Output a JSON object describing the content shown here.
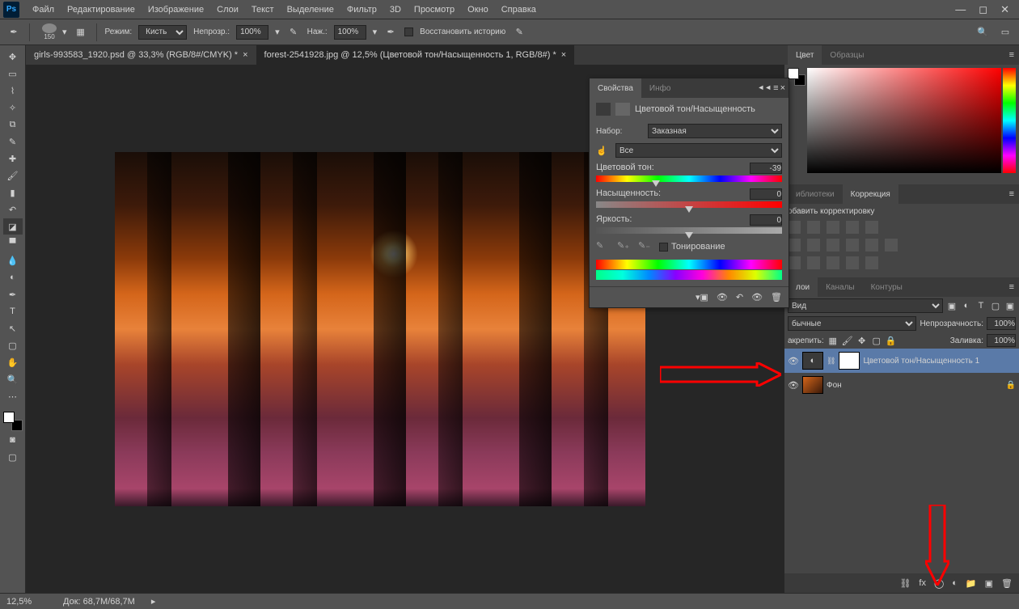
{
  "menu": {
    "items": [
      "Файл",
      "Редактирование",
      "Изображение",
      "Слои",
      "Текст",
      "Выделение",
      "Фильтр",
      "3D",
      "Просмотр",
      "Окно",
      "Справка"
    ]
  },
  "options": {
    "brush_size": "150",
    "mode_label": "Режим:",
    "mode_value": "Кисть",
    "opacity_label": "Непрозр.:",
    "opacity_value": "100%",
    "flow_label": "Наж.:",
    "flow_value": "100%",
    "restore_label": "Восстановить историю"
  },
  "tabs": [
    {
      "title": "girls-993583_1920.psd @ 33,3% (RGB/8#/CMYK) *",
      "active": false
    },
    {
      "title": "forest-2541928.jpg @ 12,5% (Цветовой тон/Насыщенность 1, RGB/8#) *",
      "active": true
    }
  ],
  "properties": {
    "tab_props": "Свойства",
    "tab_info": "Инфо",
    "title": "Цветовой тон/Насыщенность",
    "preset_label": "Набор:",
    "preset_value": "Заказная",
    "range_value": "Все",
    "hue_label": "Цветовой тон:",
    "hue_value": "-39",
    "sat_label": "Насыщенность:",
    "sat_value": "0",
    "light_label": "Яркость:",
    "light_value": "0",
    "colorize_label": "Тонирование"
  },
  "color_panel": {
    "tab_color": "Цвет",
    "tab_swatches": "Образцы"
  },
  "libraries_panel": {
    "tab_lib": "иблиотеки",
    "tab_adjust": "Коррекция",
    "title": "обавить корректировку"
  },
  "channels_panel": {
    "tab_layers": "лои",
    "tab_channels": "Каналы",
    "tab_paths": "Контуры"
  },
  "layers": {
    "kind_value": "Вид",
    "blend_value": "бычные",
    "opacity_label": "Непрозрачность:",
    "opacity_value": "100%",
    "lock_label": "акрепить:",
    "fill_label": "Заливка:",
    "fill_value": "100%",
    "items": [
      {
        "name": "Цветовой тон/Насыщенность 1",
        "selected": true,
        "type": "adjustment"
      },
      {
        "name": "Фон",
        "selected": false,
        "type": "bg"
      }
    ]
  },
  "status": {
    "zoom": "12,5%",
    "doc": "Док: 68,7M/68,7M"
  }
}
